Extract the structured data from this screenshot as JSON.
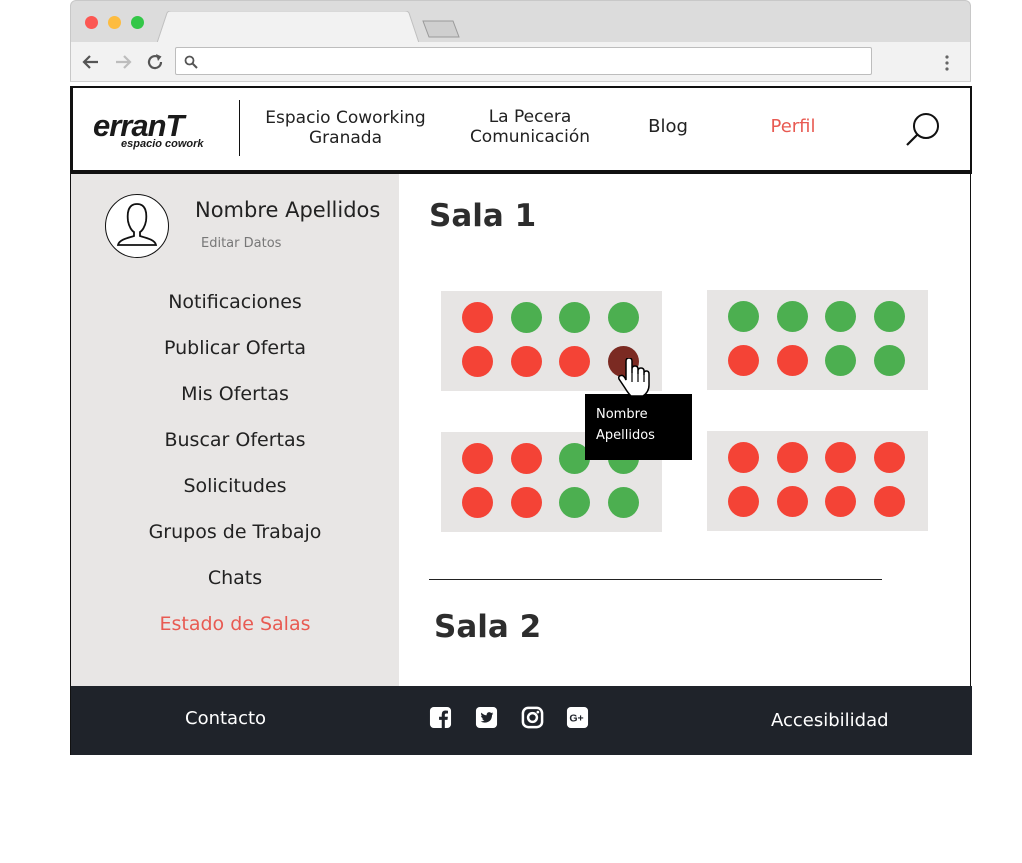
{
  "browser": {
    "url_value": "",
    "url_placeholder": ""
  },
  "header": {
    "logo_main": "erranT",
    "logo_sub": "espacio cowork",
    "nav": [
      {
        "label": "Espacio Coworking Granada"
      },
      {
        "label": "La Pecera Comunicación"
      },
      {
        "label": "Blog"
      },
      {
        "label": "Perfil"
      }
    ],
    "active_color": "#e85a52"
  },
  "sidebar": {
    "user_name": "Nombre Apellidos",
    "edit_label": "Editar Datos",
    "items": [
      {
        "label": "Notificaciones"
      },
      {
        "label": "Publicar Oferta"
      },
      {
        "label": "Mis Ofertas"
      },
      {
        "label": "Buscar Ofertas"
      },
      {
        "label": "Solicitudes"
      },
      {
        "label": "Grupos de Trabajo"
      },
      {
        "label": "Chats"
      },
      {
        "label": "Estado de Salas"
      }
    ],
    "active_item": "Estado de Salas"
  },
  "rooms": [
    {
      "title": "Sala 1",
      "tables": [
        {
          "seats": [
            "occupied",
            "free",
            "free",
            "free",
            "occupied",
            "occupied",
            "occupied",
            "selected"
          ]
        },
        {
          "seats": [
            "free",
            "free",
            "free",
            "free",
            "occupied",
            "occupied",
            "free",
            "free"
          ]
        },
        {
          "seats": [
            "occupied",
            "occupied",
            "free",
            "free",
            "occupied",
            "occupied",
            "free",
            "free"
          ]
        },
        {
          "seats": [
            "occupied",
            "occupied",
            "occupied",
            "occupied",
            "occupied",
            "occupied",
            "occupied",
            "occupied"
          ]
        }
      ]
    },
    {
      "title": "Sala 2"
    }
  ],
  "seat_colors": {
    "occupied": "#f44336",
    "free": "#4caf50",
    "selected": "#7b2a22"
  },
  "tooltip": {
    "line1": "Nombre",
    "line2": "Apellidos"
  },
  "footer": {
    "contact": "Contacto",
    "accessibility": "Accesibilidad",
    "social_icons": [
      "facebook-icon",
      "twitter-icon",
      "instagram-icon",
      "google-plus-icon"
    ]
  }
}
